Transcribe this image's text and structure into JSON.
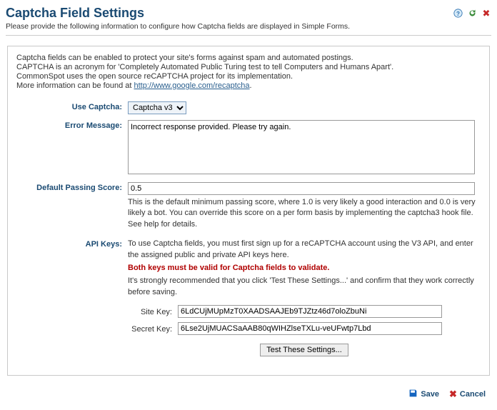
{
  "header": {
    "title": "Captcha Field Settings",
    "subtitle": "Please provide the following information to configure how Captcha fields are displayed in Simple Forms."
  },
  "intro": {
    "line1": "Captcha fields can be enabled to protect your site's forms against spam and automated postings.",
    "line2": "CAPTCHA is an acronym for 'Completely Automated Public Turing test to tell Computers and Humans Apart'.",
    "line3": "CommonSpot uses the open source reCAPTCHA project for its implementation.",
    "line4_prefix": "More information can be found at ",
    "line4_link": "http://www.google.com/recaptcha",
    "line4_suffix": "."
  },
  "form": {
    "use_captcha": {
      "label": "Use Captcha:",
      "value": "Captcha v3"
    },
    "error_message": {
      "label": "Error Message:",
      "value": "Incorrect response provided. Please try again."
    },
    "default_passing_score": {
      "label": "Default Passing Score:",
      "value": "0.5",
      "help": "This is the default minimum passing score, where 1.0 is very likely a good interaction and 0.0 is very likely a bot. You can override this score on a per form basis by implementing the captcha3 hook file. See help for details."
    },
    "api_keys": {
      "label": "API Keys:",
      "help1": "To use Captcha fields, you must first sign up for a reCAPTCHA account using the V3 API, and enter the assigned public and private API keys here.",
      "warn": "Both keys must be valid for Captcha fields to validate.",
      "help2": "It's strongly recommended that you click 'Test These Settings...' and confirm that they work correctly before saving.",
      "site_key": {
        "label": "Site Key:",
        "value": "6LdCUjMUpMzT0XAADSAAJEb9TJZtz46d7oloZbuNi"
      },
      "secret_key": {
        "label": "Secret Key:",
        "value": "6Lse2UjMUACSaAAB80qWIHZlseTXLu-veUFwtp7Lbd"
      },
      "test_button": "Test These Settings..."
    }
  },
  "footer": {
    "save": "Save",
    "cancel": "Cancel"
  }
}
